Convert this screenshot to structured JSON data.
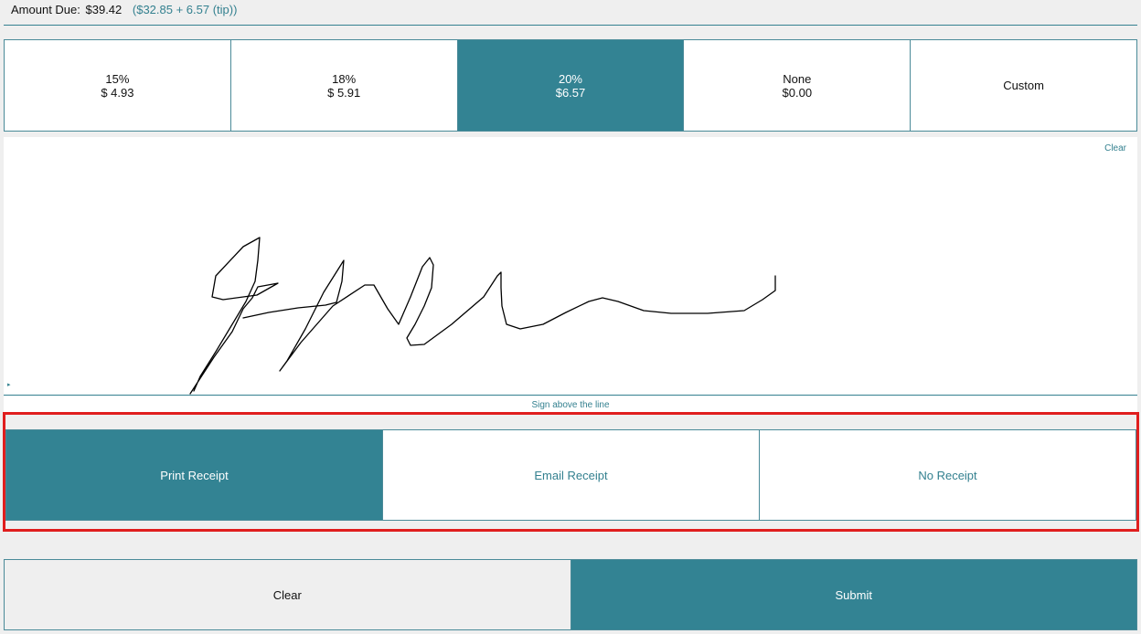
{
  "header": {
    "amount_label": "Amount Due:",
    "amount_value": "$39.42",
    "breakdown": "($32.85 + 6.57 (tip))"
  },
  "tip_options": [
    {
      "percent": "15%",
      "amount": "$ 4.93"
    },
    {
      "percent": "18%",
      "amount": "$ 5.91"
    },
    {
      "percent": "20%",
      "amount": "$6.57",
      "selected": true
    },
    {
      "percent": "None",
      "amount": "$0.00"
    },
    {
      "percent": "Custom",
      "amount": ""
    }
  ],
  "signature": {
    "clear_label": "Clear",
    "marker": "▸",
    "hint": "Sign above the line"
  },
  "receipt_options": [
    {
      "label": "Print Receipt",
      "selected": true
    },
    {
      "label": "Email Receipt"
    },
    {
      "label": "No Receipt"
    }
  ],
  "actions": {
    "clear_label": "Clear",
    "submit_label": "Submit"
  },
  "colors": {
    "accent": "#338393",
    "highlight_border": "#e01e1e",
    "background": "#efefef"
  }
}
